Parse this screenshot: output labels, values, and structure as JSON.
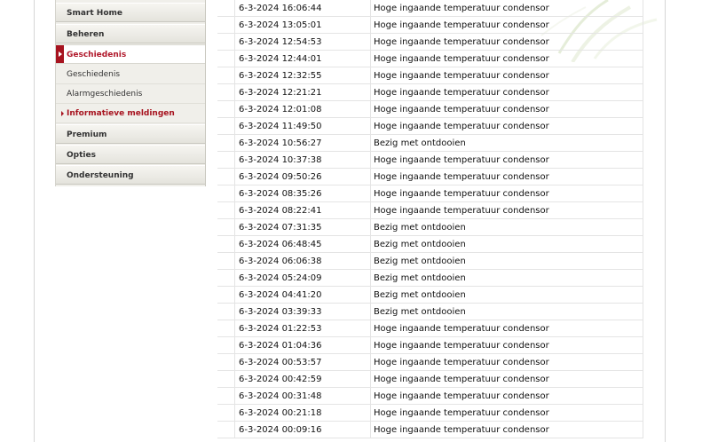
{
  "sidebar": {
    "items": [
      {
        "label": "Smart Home",
        "kind": "main"
      },
      {
        "label": "Beheren",
        "kind": "main"
      },
      {
        "label": "Geschiedenis",
        "kind": "active"
      },
      {
        "label": "Geschiedenis",
        "kind": "sub"
      },
      {
        "label": "Alarmgeschiedenis",
        "kind": "sub"
      },
      {
        "label": "Informatieve meldingen",
        "kind": "sub-active"
      },
      {
        "label": "Premium",
        "kind": "main"
      },
      {
        "label": "Opties",
        "kind": "main"
      },
      {
        "label": "Ondersteuning",
        "kind": "main"
      }
    ]
  },
  "colors": {
    "accent": "#a7131f",
    "sidebar_bg": "#f0efea",
    "row_border": "#e4e4e4"
  },
  "events": [
    {
      "datetime": "6-3-2024 16:06:44",
      "message": "Hoge ingaande temperatuur condensor"
    },
    {
      "datetime": "6-3-2024 13:05:01",
      "message": "Hoge ingaande temperatuur condensor"
    },
    {
      "datetime": "6-3-2024 12:54:53",
      "message": "Hoge ingaande temperatuur condensor"
    },
    {
      "datetime": "6-3-2024 12:44:01",
      "message": "Hoge ingaande temperatuur condensor"
    },
    {
      "datetime": "6-3-2024 12:32:55",
      "message": "Hoge ingaande temperatuur condensor"
    },
    {
      "datetime": "6-3-2024 12:21:21",
      "message": "Hoge ingaande temperatuur condensor"
    },
    {
      "datetime": "6-3-2024 12:01:08",
      "message": "Hoge ingaande temperatuur condensor"
    },
    {
      "datetime": "6-3-2024 11:49:50",
      "message": "Hoge ingaande temperatuur condensor"
    },
    {
      "datetime": "6-3-2024 10:56:27",
      "message": "Bezig met ontdooien"
    },
    {
      "datetime": "6-3-2024 10:37:38",
      "message": "Hoge ingaande temperatuur condensor"
    },
    {
      "datetime": "6-3-2024 09:50:26",
      "message": "Hoge ingaande temperatuur condensor"
    },
    {
      "datetime": "6-3-2024 08:35:26",
      "message": "Hoge ingaande temperatuur condensor"
    },
    {
      "datetime": "6-3-2024 08:22:41",
      "message": "Hoge ingaande temperatuur condensor"
    },
    {
      "datetime": "6-3-2024 07:31:35",
      "message": "Bezig met ontdooien"
    },
    {
      "datetime": "6-3-2024 06:48:45",
      "message": "Bezig met ontdooien"
    },
    {
      "datetime": "6-3-2024 06:06:38",
      "message": "Bezig met ontdooien"
    },
    {
      "datetime": "6-3-2024 05:24:09",
      "message": "Bezig met ontdooien"
    },
    {
      "datetime": "6-3-2024 04:41:20",
      "message": "Bezig met ontdooien"
    },
    {
      "datetime": "6-3-2024 03:39:33",
      "message": "Bezig met ontdooien"
    },
    {
      "datetime": "6-3-2024 01:22:53",
      "message": "Hoge ingaande temperatuur condensor"
    },
    {
      "datetime": "6-3-2024 01:04:36",
      "message": "Hoge ingaande temperatuur condensor"
    },
    {
      "datetime": "6-3-2024 00:53:57",
      "message": "Hoge ingaande temperatuur condensor"
    },
    {
      "datetime": "6-3-2024 00:42:59",
      "message": "Hoge ingaande temperatuur condensor"
    },
    {
      "datetime": "6-3-2024 00:31:48",
      "message": "Hoge ingaande temperatuur condensor"
    },
    {
      "datetime": "6-3-2024 00:21:18",
      "message": "Hoge ingaande temperatuur condensor"
    },
    {
      "datetime": "6-3-2024 00:09:16",
      "message": "Hoge ingaande temperatuur condensor"
    }
  ]
}
